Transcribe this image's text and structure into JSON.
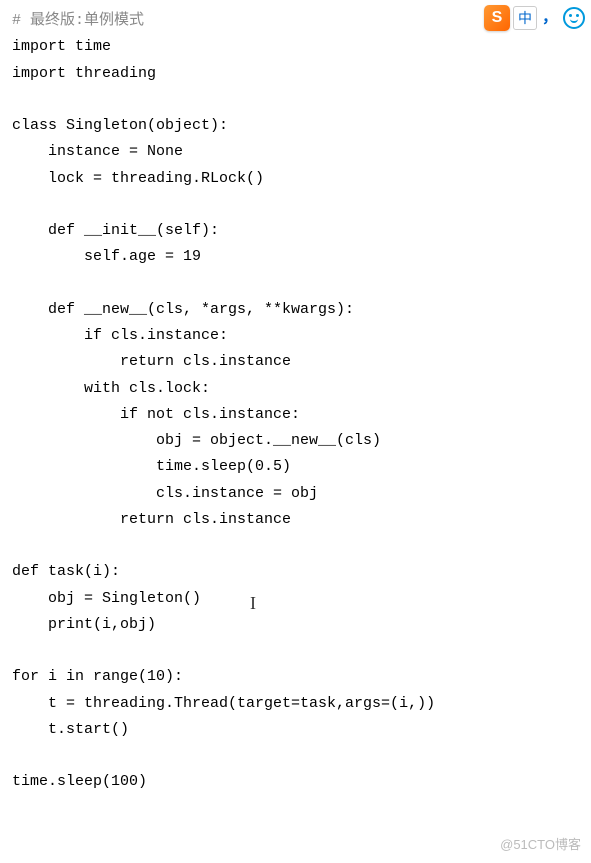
{
  "code": {
    "line1_prefix": "# ",
    "line1_text": "最终版:单例模式",
    "line2": "import time",
    "line3": "import threading",
    "line4": "",
    "line5": "class Singleton(object):",
    "line6": "    instance = None",
    "line7": "    lock = threading.RLock()",
    "line8": "",
    "line9": "    def __init__(self):",
    "line10": "        self.age = 19",
    "line11": "",
    "line12": "    def __new__(cls, *args, **kwargs):",
    "line13": "        if cls.instance:",
    "line14": "            return cls.instance",
    "line15": "        with cls.lock:",
    "line16": "            if not cls.instance:",
    "line17": "                obj = object.__new__(cls)",
    "line18": "                time.sleep(0.5)",
    "line19": "                cls.instance = obj",
    "line20": "            return cls.instance",
    "line21": "",
    "line22": "def task(i):",
    "line23": "    obj = Singleton()",
    "line24": "    print(i,obj)",
    "line25": "",
    "line26": "for i in range(10):",
    "line27": "    t = threading.Thread(target=task,args=(i,))",
    "line28": "    t.start()",
    "line29": "",
    "line30": "time.sleep(100)"
  },
  "cursor": "I",
  "ime": {
    "logo": "S",
    "zhong": "中",
    "punct": "，",
    "face": ""
  },
  "watermark": "@51CTO博客"
}
